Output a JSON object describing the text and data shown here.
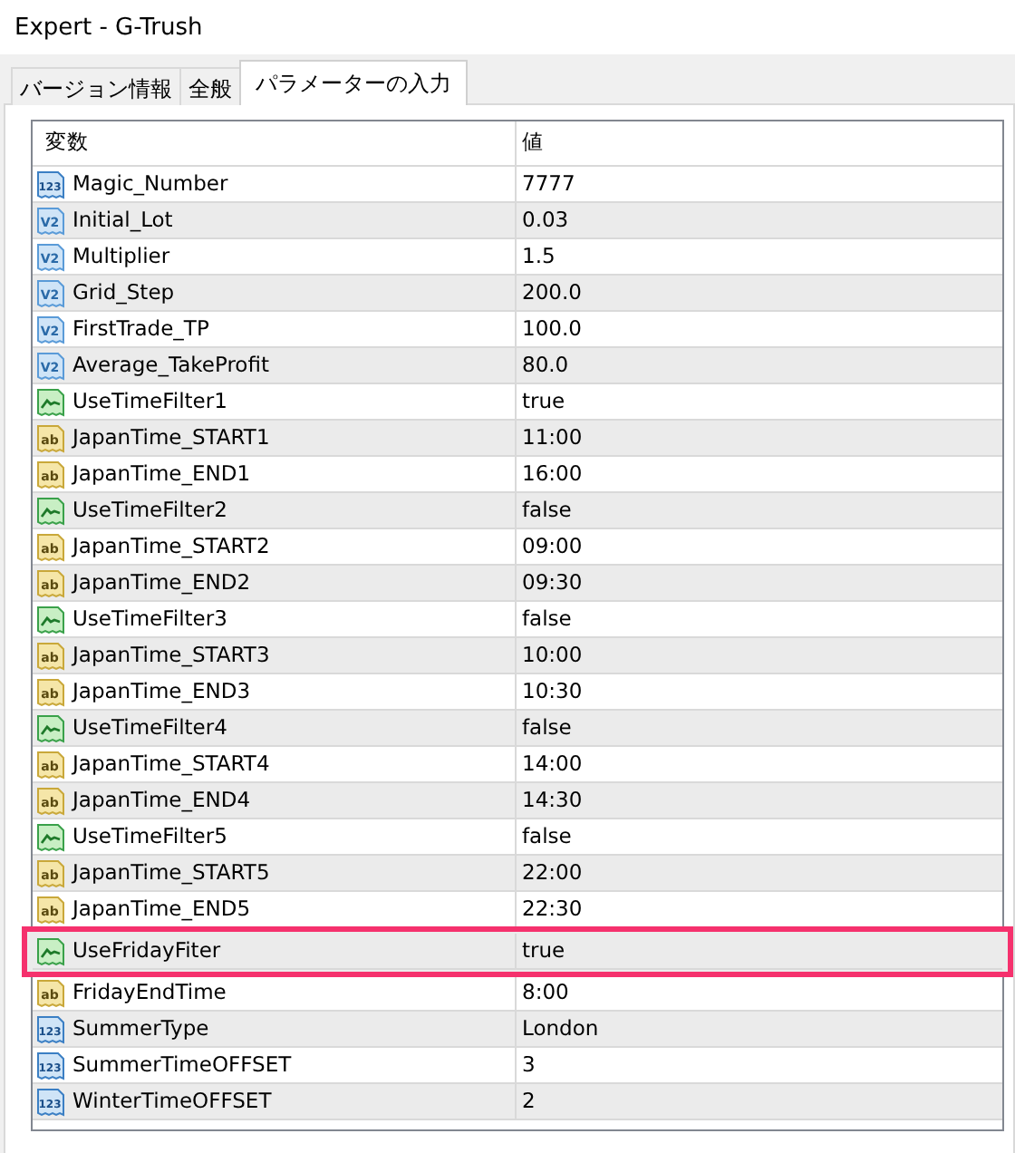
{
  "window": {
    "title": "Expert - G-Trush"
  },
  "tabs": [
    {
      "label": "バージョン情報",
      "selected": false
    },
    {
      "label": "全般",
      "selected": false
    },
    {
      "label": "パラメーターの入力",
      "selected": true
    }
  ],
  "table": {
    "columns": [
      "変数",
      "値"
    ],
    "rows": [
      {
        "kind": "int",
        "icon_label": "123",
        "name": "Magic_Number",
        "value": "7777",
        "highlighted": false
      },
      {
        "kind": "double",
        "icon_label": "V2",
        "name": "Initial_Lot",
        "value": "0.03",
        "highlighted": false
      },
      {
        "kind": "double",
        "icon_label": "V2",
        "name": "Multiplier",
        "value": "1.5",
        "highlighted": false
      },
      {
        "kind": "double",
        "icon_label": "V2",
        "name": "Grid_Step",
        "value": "200.0",
        "highlighted": false
      },
      {
        "kind": "double",
        "icon_label": "V2",
        "name": "FirstTrade_TP",
        "value": "100.0",
        "highlighted": false
      },
      {
        "kind": "double",
        "icon_label": "V2",
        "name": "Average_TakeProfit",
        "value": "80.0",
        "highlighted": false
      },
      {
        "kind": "bool",
        "name": "UseTimeFilter1",
        "value": "true",
        "highlighted": false
      },
      {
        "kind": "string",
        "icon_label": "ab",
        "name": "JapanTime_START1",
        "value": "11:00",
        "highlighted": false
      },
      {
        "kind": "string",
        "icon_label": "ab",
        "name": "JapanTime_END1",
        "value": "16:00",
        "highlighted": false
      },
      {
        "kind": "bool",
        "name": "UseTimeFilter2",
        "value": "false",
        "highlighted": false
      },
      {
        "kind": "string",
        "icon_label": "ab",
        "name": "JapanTime_START2",
        "value": "09:00",
        "highlighted": false
      },
      {
        "kind": "string",
        "icon_label": "ab",
        "name": "JapanTime_END2",
        "value": "09:30",
        "highlighted": false
      },
      {
        "kind": "bool",
        "name": "UseTimeFilter3",
        "value": "false",
        "highlighted": false
      },
      {
        "kind": "string",
        "icon_label": "ab",
        "name": "JapanTime_START3",
        "value": "10:00",
        "highlighted": false
      },
      {
        "kind": "string",
        "icon_label": "ab",
        "name": "JapanTime_END3",
        "value": "10:30",
        "highlighted": false
      },
      {
        "kind": "bool",
        "name": "UseTimeFilter4",
        "value": "false",
        "highlighted": false
      },
      {
        "kind": "string",
        "icon_label": "ab",
        "name": "JapanTime_START4",
        "value": "14:00",
        "highlighted": false
      },
      {
        "kind": "string",
        "icon_label": "ab",
        "name": "JapanTime_END4",
        "value": "14:30",
        "highlighted": false
      },
      {
        "kind": "bool",
        "name": "UseTimeFilter5",
        "value": "false",
        "highlighted": false
      },
      {
        "kind": "string",
        "icon_label": "ab",
        "name": "JapanTime_START5",
        "value": "22:00",
        "highlighted": false
      },
      {
        "kind": "string",
        "icon_label": "ab",
        "name": "JapanTime_END5",
        "value": "22:30",
        "highlighted": false
      },
      {
        "kind": "bool",
        "name": "UseFridayFiter",
        "value": "true",
        "highlighted": true
      },
      {
        "kind": "string",
        "icon_label": "ab",
        "name": "FridayEndTime",
        "value": "8:00",
        "highlighted": false
      },
      {
        "kind": "int",
        "icon_label": "123",
        "name": "SummerType",
        "value": "London",
        "highlighted": false
      },
      {
        "kind": "int",
        "icon_label": "123",
        "name": "SummerTimeOFFSET",
        "value": "3",
        "highlighted": false
      },
      {
        "kind": "int",
        "icon_label": "123",
        "name": "WinterTimeOFFSET",
        "value": "2",
        "highlighted": false
      }
    ]
  }
}
